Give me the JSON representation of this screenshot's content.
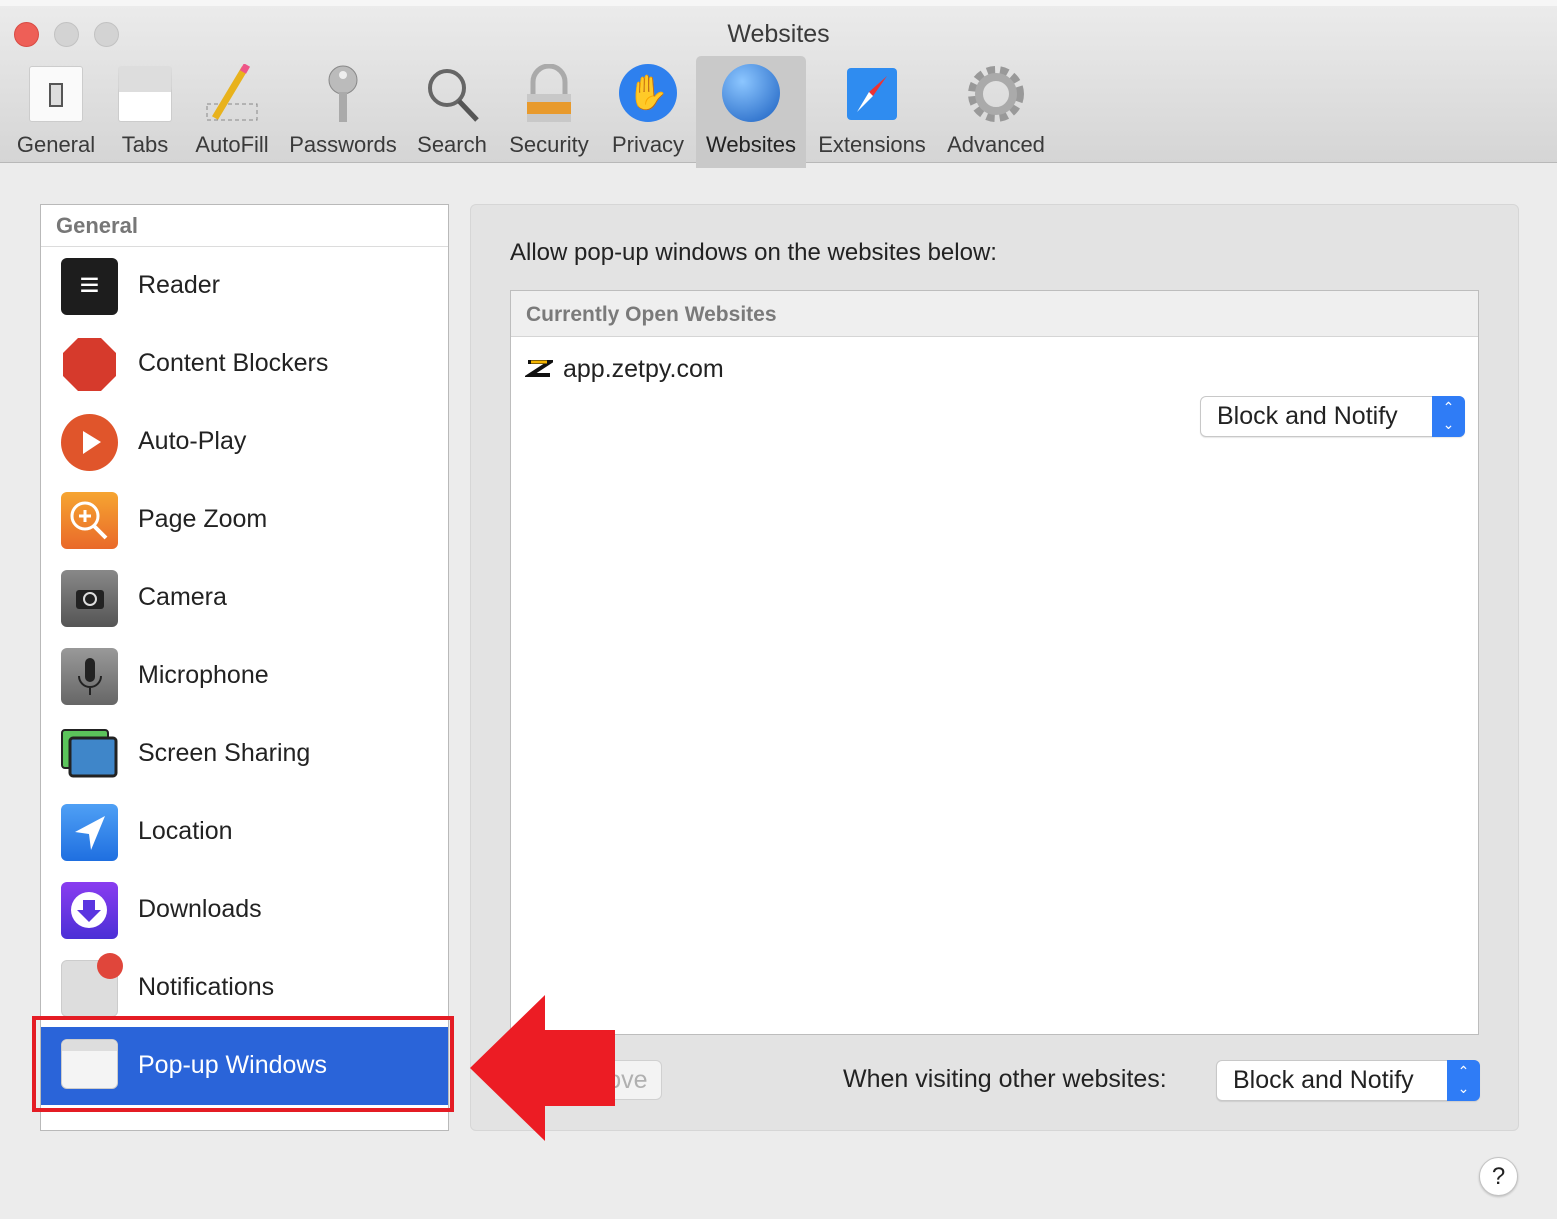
{
  "window": {
    "title": "Websites"
  },
  "toolbar": {
    "items": [
      {
        "label": "General",
        "icon": "switch-icon"
      },
      {
        "label": "Tabs",
        "icon": "tabs-icon"
      },
      {
        "label": "AutoFill",
        "icon": "pencil-icon"
      },
      {
        "label": "Passwords",
        "icon": "key-icon"
      },
      {
        "label": "Search",
        "icon": "magnifier-icon"
      },
      {
        "label": "Security",
        "icon": "padlock-icon"
      },
      {
        "label": "Privacy",
        "icon": "hand-icon"
      },
      {
        "label": "Websites",
        "icon": "globe-icon",
        "selected": true
      },
      {
        "label": "Extensions",
        "icon": "puzzle-compass-icon"
      },
      {
        "label": "Advanced",
        "icon": "gear-icon"
      }
    ]
  },
  "sidebar": {
    "header": "General",
    "items": [
      {
        "label": "Reader",
        "icon": "reader-icon"
      },
      {
        "label": "Content Blockers",
        "icon": "stop-sign-icon"
      },
      {
        "label": "Auto-Play",
        "icon": "play-icon"
      },
      {
        "label": "Page Zoom",
        "icon": "zoom-icon"
      },
      {
        "label": "Camera",
        "icon": "camera-icon"
      },
      {
        "label": "Microphone",
        "icon": "microphone-icon"
      },
      {
        "label": "Screen Sharing",
        "icon": "screen-sharing-icon"
      },
      {
        "label": "Location",
        "icon": "location-arrow-icon"
      },
      {
        "label": "Downloads",
        "icon": "download-icon"
      },
      {
        "label": "Notifications",
        "icon": "notification-icon"
      },
      {
        "label": "Pop-up Windows",
        "icon": "popup-window-icon",
        "selected": true
      }
    ]
  },
  "main": {
    "heading": "Allow pop-up windows on the websites below:",
    "table_header": "Currently Open Websites",
    "rows": [
      {
        "site": "app.zetpy.com",
        "setting": "Block and Notify"
      }
    ],
    "remove_label": "Remove",
    "other_label": "When visiting other websites:",
    "other_setting": "Block and Notify",
    "help": "?"
  },
  "colors": {
    "selection": "#2a64d9",
    "annotation": "#e41c24",
    "accent": "#2f7cf6"
  }
}
